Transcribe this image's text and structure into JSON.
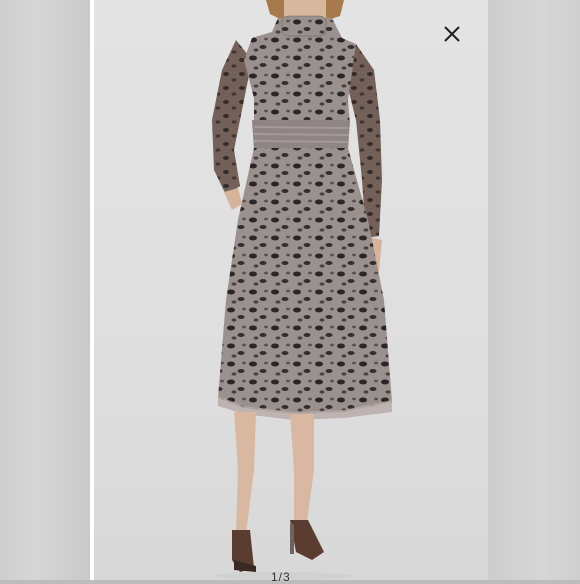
{
  "viewer": {
    "close_icon": "close-icon",
    "page_indicator": "1/3",
    "colors": {
      "background": "#e2e1e1",
      "side_panels": "#d2d2d2",
      "dress_base": "#8b8281",
      "dress_spots": "#2b2727"
    }
  }
}
